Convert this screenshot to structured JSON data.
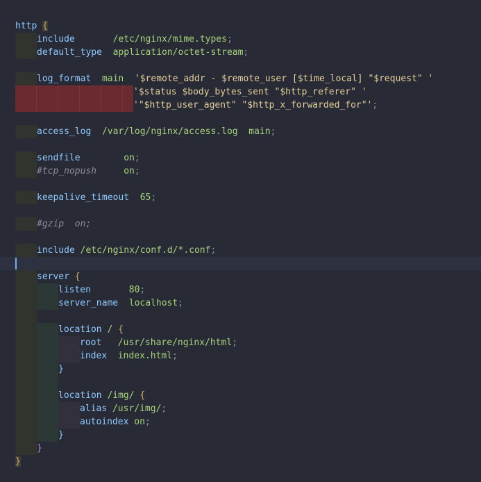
{
  "editor": {
    "lines": {
      "l1": {
        "kw": "http",
        "brace": "{"
      },
      "l2": {
        "kw": "include",
        "gap": "       ",
        "val": "/etc/nginx/mime.types",
        "semi": ";"
      },
      "l3": {
        "kw": "default_type",
        "gap": "  ",
        "val": "application/octet-stream",
        "semi": ";"
      },
      "l5": {
        "kw": "log_format",
        "gap": "  ",
        "name": "main",
        "gap2": "  ",
        "str": "'$remote_addr - $remote_user [$time_local] \"$request\" '"
      },
      "l6": {
        "str": "'$status $body_bytes_sent \"$http_referer\" '"
      },
      "l7": {
        "str": "'\"$http_user_agent\" \"$http_x_forwarded_for\"'",
        "semi": ";"
      },
      "l9": {
        "kw": "access_log",
        "gap": "  ",
        "val": "/var/log/nginx/access.log  main",
        "semi": ";"
      },
      "l11": {
        "kw": "sendfile",
        "gap": "        ",
        "val": "on",
        "semi": ";"
      },
      "l12": {
        "cmt": "#tcp_nopush",
        "gap": "     ",
        "val": "on",
        "semi": ";"
      },
      "l14": {
        "kw": "keepalive_timeout",
        "gap": "  ",
        "val": "65",
        "semi": ";"
      },
      "l16": {
        "cmt": "#gzip  on;"
      },
      "l18": {
        "kw": "include",
        "gap": " ",
        "val": "/etc/nginx/conf.d/*.conf",
        "semi": ";"
      },
      "l20": {
        "kw": "server",
        "brace": "{"
      },
      "l21": {
        "kw": "listen",
        "gap": "       ",
        "val": "80",
        "semi": ";"
      },
      "l22": {
        "kw": "server_name",
        "gap": "  ",
        "val": "localhost",
        "semi": ";"
      },
      "l24": {
        "kw": "location",
        "path": "/",
        "brace": "{"
      },
      "l25": {
        "kw": "root",
        "gap": "   ",
        "val": "/usr/share/nginx/html",
        "semi": ";"
      },
      "l26": {
        "kw": "index",
        "gap": "  ",
        "val": "index.html",
        "semi": ";"
      },
      "l27": {
        "brace": "}"
      },
      "l29": {
        "kw": "location",
        "path": "/img/",
        "brace": "{"
      },
      "l30": {
        "kw": "alias",
        "gap": " ",
        "val": "/usr/img/",
        "semi": ";"
      },
      "l31": {
        "kw": "autoindex",
        "gap": " ",
        "val": "on",
        "semi": ";"
      },
      "l32": {
        "brace": "}"
      },
      "l33": {
        "brace": "}"
      },
      "l34": {
        "brace": "}"
      }
    }
  }
}
